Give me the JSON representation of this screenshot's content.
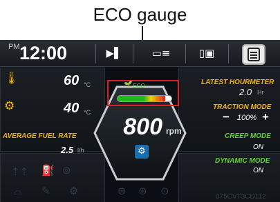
{
  "annotation": {
    "title": "ECO gauge"
  },
  "header": {
    "ampm": "PM",
    "time": "12:00",
    "icons": [
      "transmission-icon",
      "map-menu-icon",
      "display-mode-icon",
      "document-icon"
    ]
  },
  "left_panel": {
    "temp1": {
      "value": "60",
      "unit": "°C",
      "icon": "engine-coolant-temp-icon"
    },
    "temp2": {
      "value": "40",
      "unit": "°C",
      "icon": "oil-temp-icon"
    },
    "fuel_rate": {
      "label": "AVERAGE FUEL RATE",
      "value": "2.5",
      "unit": "l/h"
    }
  },
  "center": {
    "eco_label": "ECO",
    "eco_level_fraction": 0.88,
    "rpm_value": "800",
    "rpm_unit": "rpm"
  },
  "right_panel": {
    "hourmeter": {
      "label": "LATEST HOURMETER",
      "value": "2.0",
      "unit": "Hr"
    },
    "traction": {
      "label": "TRACTION MODE",
      "minus": "−",
      "value": "100%",
      "plus": "+"
    },
    "creep": {
      "label": "CREEP MODE",
      "value": "ON"
    },
    "dynamic": {
      "label": "DYNAMIC MODE",
      "value": "ON"
    },
    "serial": "075CVT3CD112"
  },
  "colors": {
    "accent_yellow": "#f0b400",
    "accent_green": "#5fd12e",
    "highlight_red": "#e02020"
  }
}
